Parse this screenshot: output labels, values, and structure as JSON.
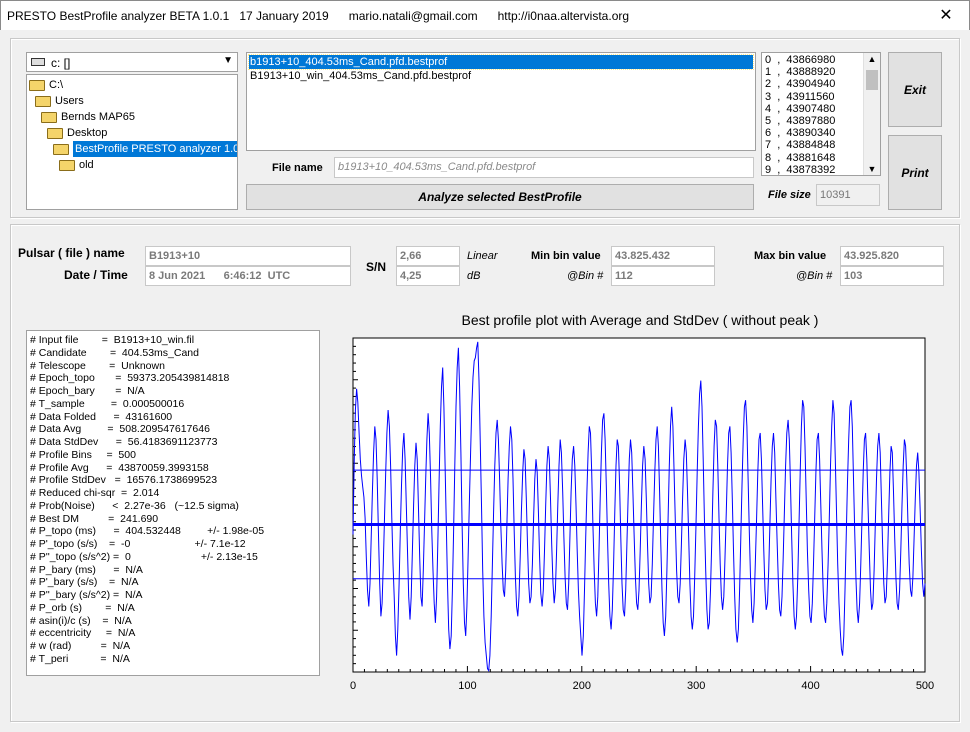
{
  "window": {
    "title": "PRESTO BestProfile analyzer BETA 1.0.1   17 January 2019      mario.natali@gmail.com      http://i0naa.altervista.org",
    "close_glyph": "✕"
  },
  "drive": {
    "label": "c: []"
  },
  "directories": [
    {
      "label": "C:\\",
      "indent": 0,
      "selected": false
    },
    {
      "label": "Users",
      "indent": 1,
      "selected": false
    },
    {
      "label": "Bernds MAP65",
      "indent": 2,
      "selected": false
    },
    {
      "label": "Desktop",
      "indent": 3,
      "selected": false
    },
    {
      "label": "BestProfile PRESTO analyzer 1.0.1.e",
      "indent": 4,
      "selected": true
    },
    {
      "label": "old",
      "indent": 5,
      "selected": false
    }
  ],
  "files": [
    {
      "label": "b1913+10_404.53ms_Cand.pfd.bestprof",
      "selected": true
    },
    {
      "label": "B1913+10_win_404.53ms_Cand.pfd.bestprof",
      "selected": false
    }
  ],
  "file_name": {
    "label": "File name",
    "value": "b1913+10_404.53ms_Cand.pfd.bestprof"
  },
  "analyze_button": "Analyze selected BestProfile",
  "bins_list": [
    "0  ,  43866980",
    "1  ,  43888920",
    "2  ,  43904940",
    "3  ,  43911560",
    "4  ,  43907480",
    "5  ,  43897880",
    "6  ,  43890340",
    "7  ,  43884848",
    "8  ,  43881648",
    "9  ,  43878392"
  ],
  "exit_button": "Exit",
  "print_button": "Print",
  "file_size": {
    "label": "File size",
    "value": "10391"
  },
  "pulsar": {
    "name_label": "Pulsar ( file ) name",
    "name_value": "B1913+10",
    "date_label": "Date / Time",
    "date_value": "8 Jun 2021      6:46:12  UTC"
  },
  "sn": {
    "label": "S/N",
    "linear_value": "2,66",
    "linear_label": "Linear",
    "db_value": "4,25",
    "db_label": "dB"
  },
  "min_bin": {
    "label": "Min bin value",
    "value": "43.825.432",
    "bin_label": "@Bin #",
    "bin_value": "112"
  },
  "max_bin": {
    "label": "Max bin value",
    "value": "43.925.820",
    "bin_label": "@Bin #",
    "bin_value": "103"
  },
  "info_lines": [
    "# Input file        =  B1913+10_win.fil",
    "# Candidate        =  404.53ms_Cand",
    "# Telescope        =  Unknown",
    "# Epoch_topo       =  59373.205439814818",
    "# Epoch_bary       =  N/A",
    "# T_sample         =  0.000500016",
    "# Data Folded      =  43161600",
    "# Data Avg         =  508.209547617646",
    "# Data StdDev      =  56.4183691123773",
    "# Profile Bins     =  500",
    "# Profile Avg      =  43870059.3993158",
    "# Profile StdDev   =  16576.1738699523",
    "# Reduced chi-sqr  =  2.014",
    "# Prob(Noise)      <  2.27e-36   (~12.5 sigma)",
    "# Best DM          =  241.690",
    "# P_topo (ms)      =  404.532448         +/- 1.98e-05",
    "# P'_topo (s/s)    =  -0                      +/- 7.1e-12",
    "# P''_topo (s/s^2) =  0                        +/- 2.13e-15",
    "# P_bary (ms)      =  N/A",
    "# P'_bary (s/s)    =  N/A",
    "# P''_bary (s/s^2) =  N/A",
    "# P_orb (s)        =  N/A",
    "# asin(i)/c (s)    =  N/A",
    "# eccentricity     =  N/A",
    "# w (rad)          =  N/A",
    "# T_peri           =  N/A"
  ],
  "colors": {
    "plot_line": "#0000ff",
    "selection": "#0078d7",
    "folder": "#f4d46a"
  },
  "chart_data": {
    "type": "line",
    "title": "Best profile plot with  Average and StdDev ( without peak )",
    "xlim": [
      0,
      500
    ],
    "ylim": [
      43825000,
      43927000
    ],
    "x_ticks": [
      0,
      100,
      200,
      300,
      400,
      500
    ],
    "average": 43870059,
    "std_upper": 43886635,
    "std_lower": 43853483,
    "series": [
      {
        "values": [
          43867000,
          43889000,
          43905000,
          43911500,
          43907500,
          43898000,
          43890000,
          43885000,
          43881600,
          43878400,
          43872000,
          43860000,
          43850000,
          43845000,
          43852000,
          43866000,
          43880000,
          43892000,
          43900000,
          43896000,
          43884000,
          43868000,
          43852000,
          43842000,
          43846000,
          43858000,
          43872000,
          43886000,
          43898000,
          43905000,
          43900000,
          43888000,
          43872000,
          43858000,
          43848000,
          43836000,
          43830000,
          43838000,
          43852000,
          43868000,
          43882000,
          43893000,
          43898000,
          43890000,
          43876000,
          43862000,
          43848000,
          43841000,
          43848000,
          43862000,
          43876000,
          43888000,
          43895000,
          43890000,
          43876000,
          43860000,
          43848000,
          43845000,
          43856000,
          43870000,
          43884000,
          43896000,
          43904000,
          43898000,
          43884000,
          43868000,
          43856000,
          43846000,
          43840000,
          43848000,
          43864000,
          43882000,
          43900000,
          43912000,
          43918000,
          43906000,
          43888000,
          43870000,
          43852000,
          43838000,
          43832000,
          43836000,
          43850000,
          43868000,
          43888000,
          43906000,
          43918000,
          43924000,
          43912000,
          43892000,
          43870000,
          43852000,
          43840000,
          43836000,
          43845000,
          43860000,
          43876000,
          43892000,
          43906000,
          43915000,
          43920000,
          43921000,
          43924000,
          43925800,
          43914000,
          43896000,
          43876000,
          43856000,
          43842000,
          43834000,
          43830000,
          43826000,
          43825432,
          43830000,
          43842000,
          43858000,
          43874000,
          43888000,
          43898000,
          43902000,
          43896000,
          43884000,
          43870000,
          43858000,
          43850000,
          43848000,
          43856000,
          43870000,
          43884000,
          43894000,
          43900000,
          43896000,
          43884000,
          43868000,
          43854000,
          43845000,
          43842000,
          43848000,
          43860000,
          43874000,
          43886000,
          43893000,
          43890000,
          43878000,
          43864000,
          43852000,
          43846000,
          43848000,
          43858000,
          43872000,
          43884000,
          43890000,
          43886000,
          43874000,
          43860000,
          43849000,
          43845000,
          43850000,
          43862000,
          43876000,
          43888000,
          43894000,
          43890000,
          43878000,
          43864000,
          43852000,
          43846000,
          43850000,
          43862000,
          43876000,
          43888000,
          43896000,
          43892000,
          43880000,
          43866000,
          43854000,
          43846000,
          43844000,
          43852000,
          43866000,
          43880000,
          43890000,
          43894000,
          43888000,
          43876000,
          43862000,
          43850000,
          43842000,
          43836000,
          43830000,
          43836000,
          43850000,
          43866000,
          43880000,
          43892000,
          43900000,
          43898000,
          43886000,
          43870000,
          43856000,
          43846000,
          43842000,
          43848000,
          43862000,
          43878000,
          43892000,
          43902000,
          43904000,
          43896000,
          43882000,
          43866000,
          43852000,
          43842000,
          43838000,
          43844000,
          43858000,
          43874000,
          43888000,
          43896000,
          43894000,
          43882000,
          43866000,
          43852000,
          43844000,
          43842000,
          43850000,
          43864000,
          43878000,
          43890000,
          43896000,
          43892000,
          43880000,
          43866000,
          43854000,
          43846000,
          43844000,
          43850000,
          43862000,
          43876000,
          43888000,
          43894000,
          43890000,
          43878000,
          43864000,
          43852000,
          43846000,
          43848000,
          43858000,
          43872000,
          43886000,
          43896000,
          43900000,
          43894000,
          43880000,
          43864000,
          43850000,
          43840000,
          43836000,
          43842000,
          43856000,
          43872000,
          43888000,
          43900000,
          43906000,
          43900000,
          43886000,
          43870000,
          43856000,
          43848000,
          43846000,
          43852000,
          43864000,
          43878000,
          43890000,
          43896000,
          43892000,
          43880000,
          43866000,
          43852000,
          43842000,
          43838000,
          43842000,
          43854000,
          43870000,
          43886000,
          43900000,
          43910000,
          43914000,
          43906000,
          43890000,
          43872000,
          43856000,
          43844000,
          43838000,
          43840000,
          43850000,
          43864000,
          43880000,
          43894000,
          43902000,
          43900000,
          43888000,
          43872000,
          43858000,
          43848000,
          43844000,
          43848000,
          43860000,
          43874000,
          43888000,
          43898000,
          43900000,
          43892000,
          43878000,
          43862000,
          43848000,
          43838000,
          43834000,
          43838000,
          43850000,
          43866000,
          43882000,
          43896000,
          43906000,
          43908000,
          43900000,
          43884000,
          43868000,
          43854000,
          43844000,
          43840000,
          43846000,
          43858000,
          43872000,
          43886000,
          43896000,
          43898000,
          43890000,
          43876000,
          43862000,
          43850000,
          43844000,
          43846000,
          43856000,
          43870000,
          43884000,
          43894000,
          43898000,
          43892000,
          43878000,
          43864000,
          43852000,
          43844000,
          43842000,
          43848000,
          43860000,
          43874000,
          43888000,
          43898000,
          43902000,
          43896000,
          43882000,
          43866000,
          43852000,
          43842000,
          43838000,
          43842000,
          43854000,
          43870000,
          43886000,
          43900000,
          43908000,
          43906000,
          43894000,
          43878000,
          43862000,
          43850000,
          43842000,
          43840000,
          43846000,
          43858000,
          43872000,
          43886000,
          43896000,
          43898000,
          43890000,
          43876000,
          43862000,
          43850000,
          43842000,
          43840000,
          43846000,
          43858000,
          43872000,
          43888000,
          43900000,
          43908000,
          43904000,
          43890000,
          43874000,
          43858000,
          43846000,
          43838000,
          43832000,
          43830000,
          43836000,
          43850000,
          43866000,
          43882000,
          43896000,
          43906000,
          43908000,
          43900000,
          43884000,
          43868000,
          43854000,
          43844000,
          43840000,
          43846000,
          43858000,
          43872000,
          43886000,
          43896000,
          43898000,
          43890000,
          43876000,
          43862000,
          43850000,
          43844000,
          43846000,
          43856000,
          43870000,
          43884000,
          43894000,
          43898000,
          43892000,
          43878000,
          43864000,
          43852000,
          43846000,
          43848000,
          43858000,
          43872000,
          43886000,
          43894000,
          43892000,
          43880000,
          43866000,
          43854000,
          43846000,
          43844000,
          43850000,
          43862000,
          43876000,
          43888000,
          43896000,
          43894000,
          43884000,
          43870000,
          43858000,
          43850000,
          43848000,
          43854000,
          43866000,
          43878000,
          43888000,
          43892000,
          43886000,
          43874000,
          43862000,
          43852000,
          43848000,
          43852000
        ]
      }
    ]
  }
}
